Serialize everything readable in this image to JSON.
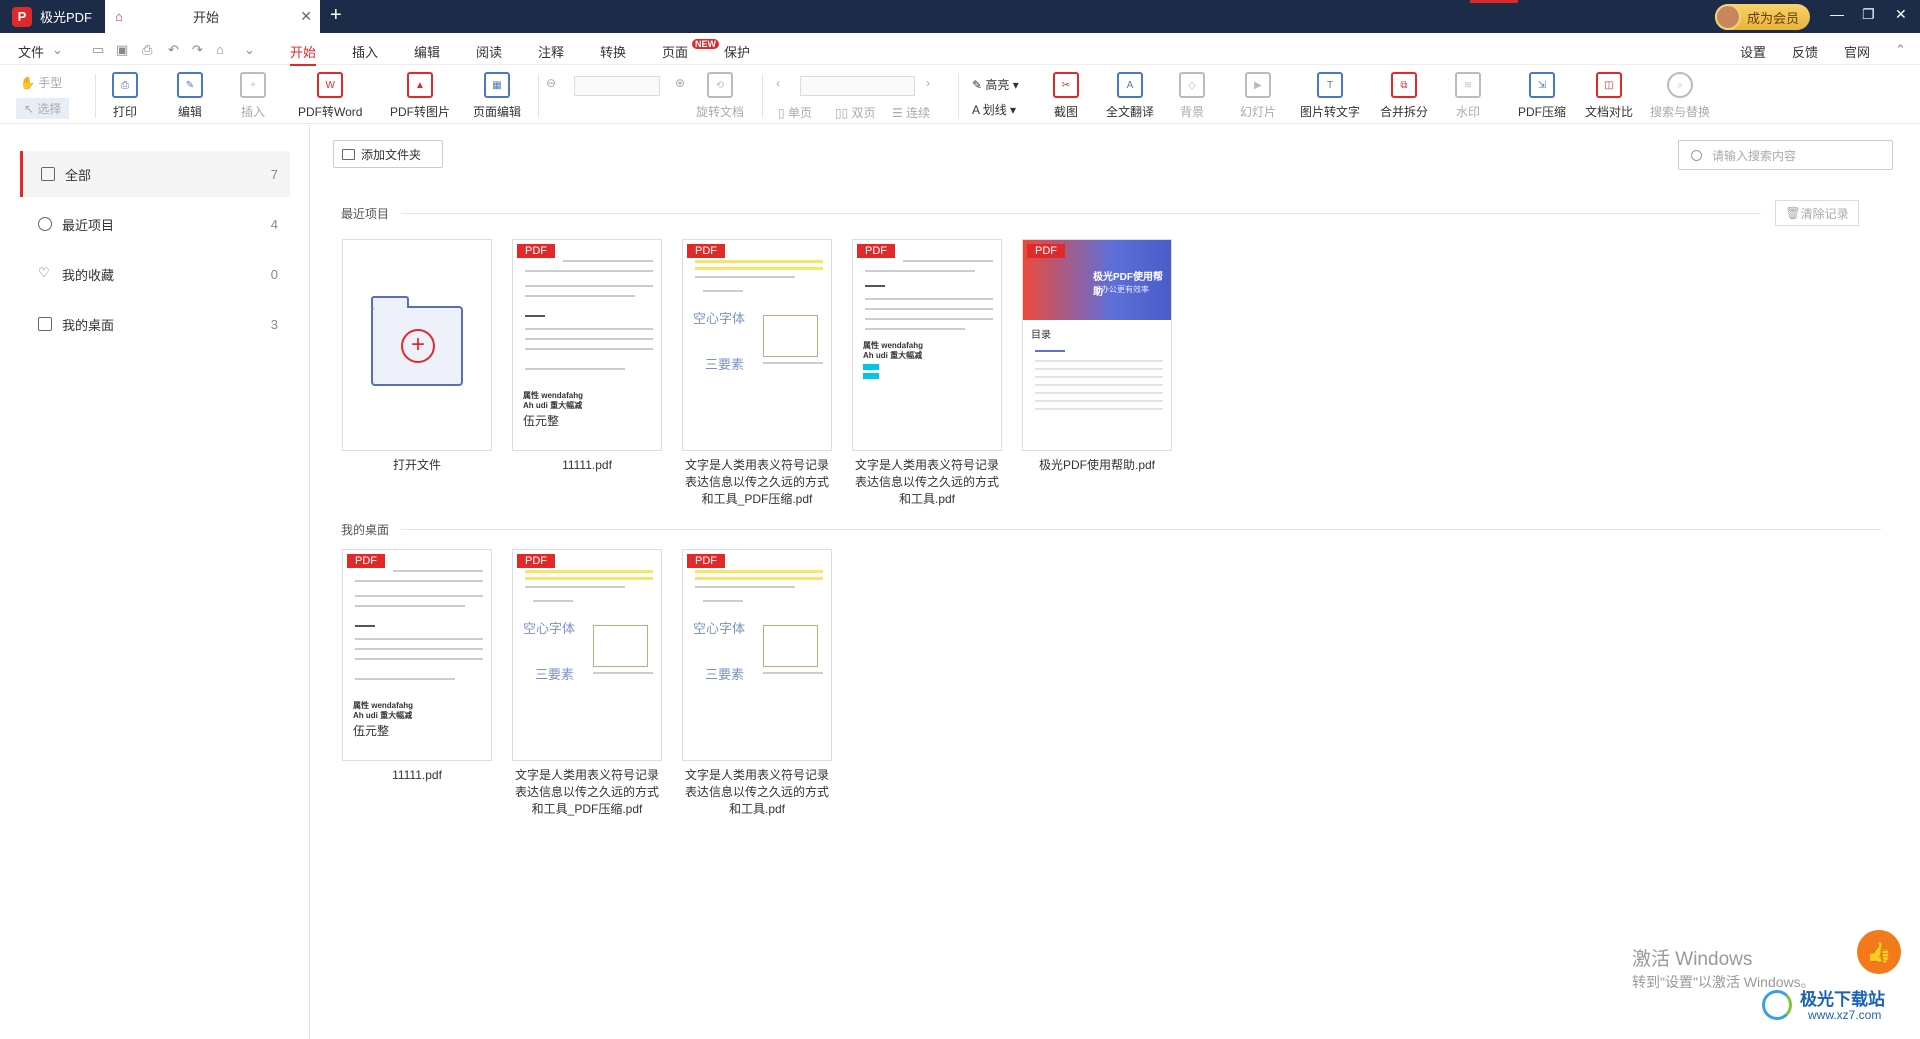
{
  "titlebar": {
    "app_name": "极光PDF",
    "tab_label": "开始",
    "new_tab": "+",
    "member_label": "成为会员",
    "controls": [
      "—",
      "❐",
      "✕"
    ]
  },
  "menu": {
    "file": "文件",
    "tabs": [
      "开始",
      "插入",
      "编辑",
      "阅读",
      "注释",
      "转换",
      "页面",
      "保护"
    ],
    "new_badge": "NEW",
    "right": [
      "设置",
      "反馈",
      "官网"
    ]
  },
  "ribbon": {
    "hand": "手型",
    "select": "选择",
    "print": "打印",
    "edit": "编辑",
    "insert": "插入",
    "pdf_to_word": "PDF转Word",
    "pdf_to_image": "PDF转图片",
    "page_edit": "页面编辑",
    "rotate": "旋转文档",
    "single": "单页",
    "double": "双页",
    "continuous": "连续",
    "highlight": "高亮",
    "strike": "划线",
    "screenshot": "截图",
    "translate": "全文翻译",
    "background": "背景",
    "slideshow": "幻灯片",
    "ocr": "图片转文字",
    "merge_split": "合并拆分",
    "watermark": "水印",
    "compress": "PDF压缩",
    "compare": "文档对比",
    "search_replace": "搜索与替换"
  },
  "sidebar": {
    "items": [
      {
        "label": "全部",
        "count": "7"
      },
      {
        "label": "最近项目",
        "count": "4"
      },
      {
        "label": "我的收藏",
        "count": "0"
      },
      {
        "label": "我的桌面",
        "count": "3"
      }
    ]
  },
  "main": {
    "add_folder": "添加文件夹",
    "search_placeholder": "请输入搜索内容",
    "clear_history": "清除记录",
    "recent_title": "最近项目",
    "desktop_title": "我的桌面",
    "pdf_tag": "PDF",
    "recent_files": [
      {
        "name": "打开文件"
      },
      {
        "name": "11111.pdf"
      },
      {
        "name": "文字是人类用表义符号记录表达信息以传之久远的方式和工具_PDF压缩.pdf"
      },
      {
        "name": "文字是人类用表义符号记录表达信息以传之久远的方式和工具.pdf"
      },
      {
        "name": "极光PDF使用帮助.pdf"
      }
    ],
    "desktop_files": [
      {
        "name": "11111.pdf"
      },
      {
        "name": "文字是人类用表义符号记录表达信息以传之久远的方式和工具_PDF压缩.pdf"
      },
      {
        "name": "文字是人类用表义符号记录表达信息以传之久远的方式和工具.pdf"
      }
    ],
    "thumb_text": {
      "bold1": "属性 wendafahg",
      "bold2": "Ah udi 重大幅减",
      "cn_big": "伍元整",
      "heart_font": "空心字体",
      "three": "三要素",
      "help_title": "极光PDF使用帮助",
      "help_sub": "让办公更有效率",
      "toc": "目录"
    }
  },
  "watermark": {
    "activate": "激活 Windows",
    "activate_hint": "转到\"设置\"以激活 Windows。",
    "site_name": "极光下载站",
    "site_url": "www.xz7.com"
  }
}
